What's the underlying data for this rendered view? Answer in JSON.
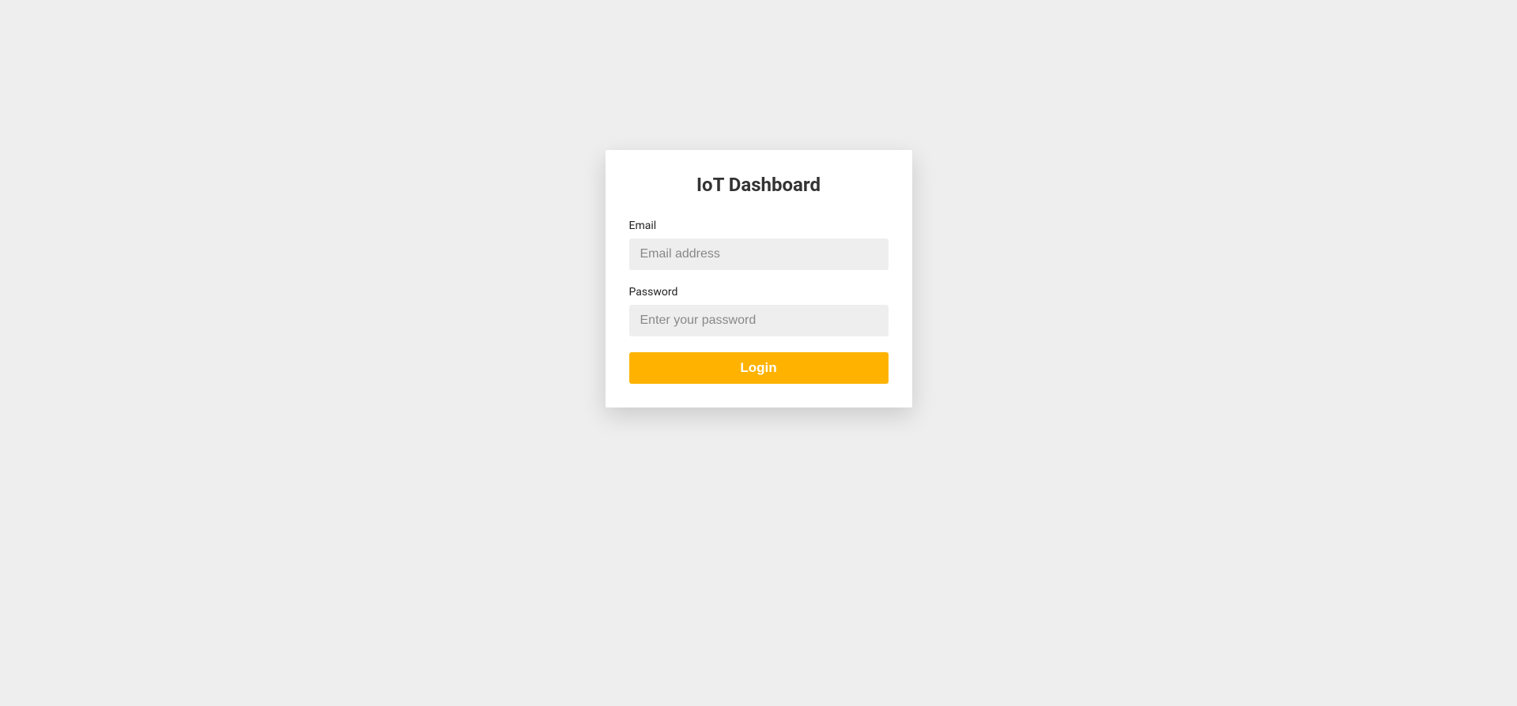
{
  "login": {
    "title": "IoT Dashboard",
    "email": {
      "label": "Email",
      "placeholder": "Email address",
      "value": ""
    },
    "password": {
      "label": "Password",
      "placeholder": "Enter your password",
      "value": ""
    },
    "button_label": "Login"
  },
  "colors": {
    "background": "#eeeeee",
    "card_background": "#ffffff",
    "accent": "#ffb300",
    "text_primary": "#333333",
    "input_background": "#eeeeee",
    "placeholder": "#888888"
  }
}
